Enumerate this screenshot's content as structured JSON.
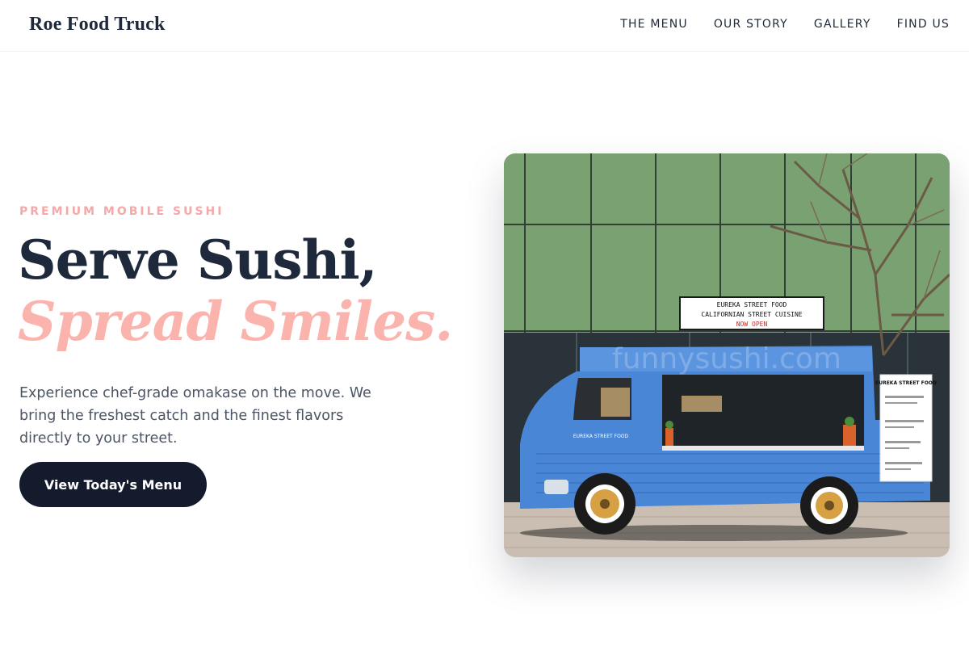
{
  "header": {
    "brand": "Roe Food Truck",
    "nav": [
      "THE MENU",
      "OUR STORY",
      "GALLERY",
      "FIND US"
    ]
  },
  "hero": {
    "eyebrow": "PREMIUM MOBILE SUSHI",
    "title_line1": "Serve Sushi,",
    "title_line2": "Spread Smiles.",
    "description": "Experience chef-grade omakase on the move. We bring the freshest catch and the finest flavors directly to your street.",
    "cta_label": "View Today's Menu"
  },
  "photo": {
    "sign_line1": "EUREKA STREET FOOD",
    "sign_line2": "CALIFORNIAN STREET CUISINE",
    "sign_line3": "NOW OPEN",
    "truck_text": "EUREKA STREET FOOD",
    "menu_board_title": "EUREKA STREET FOOD",
    "watermark": "funnysushi.com"
  },
  "colors": {
    "accent_pink": "#fbb4ad",
    "navy": "#1e293b",
    "truck_blue": "#4a86d6"
  }
}
